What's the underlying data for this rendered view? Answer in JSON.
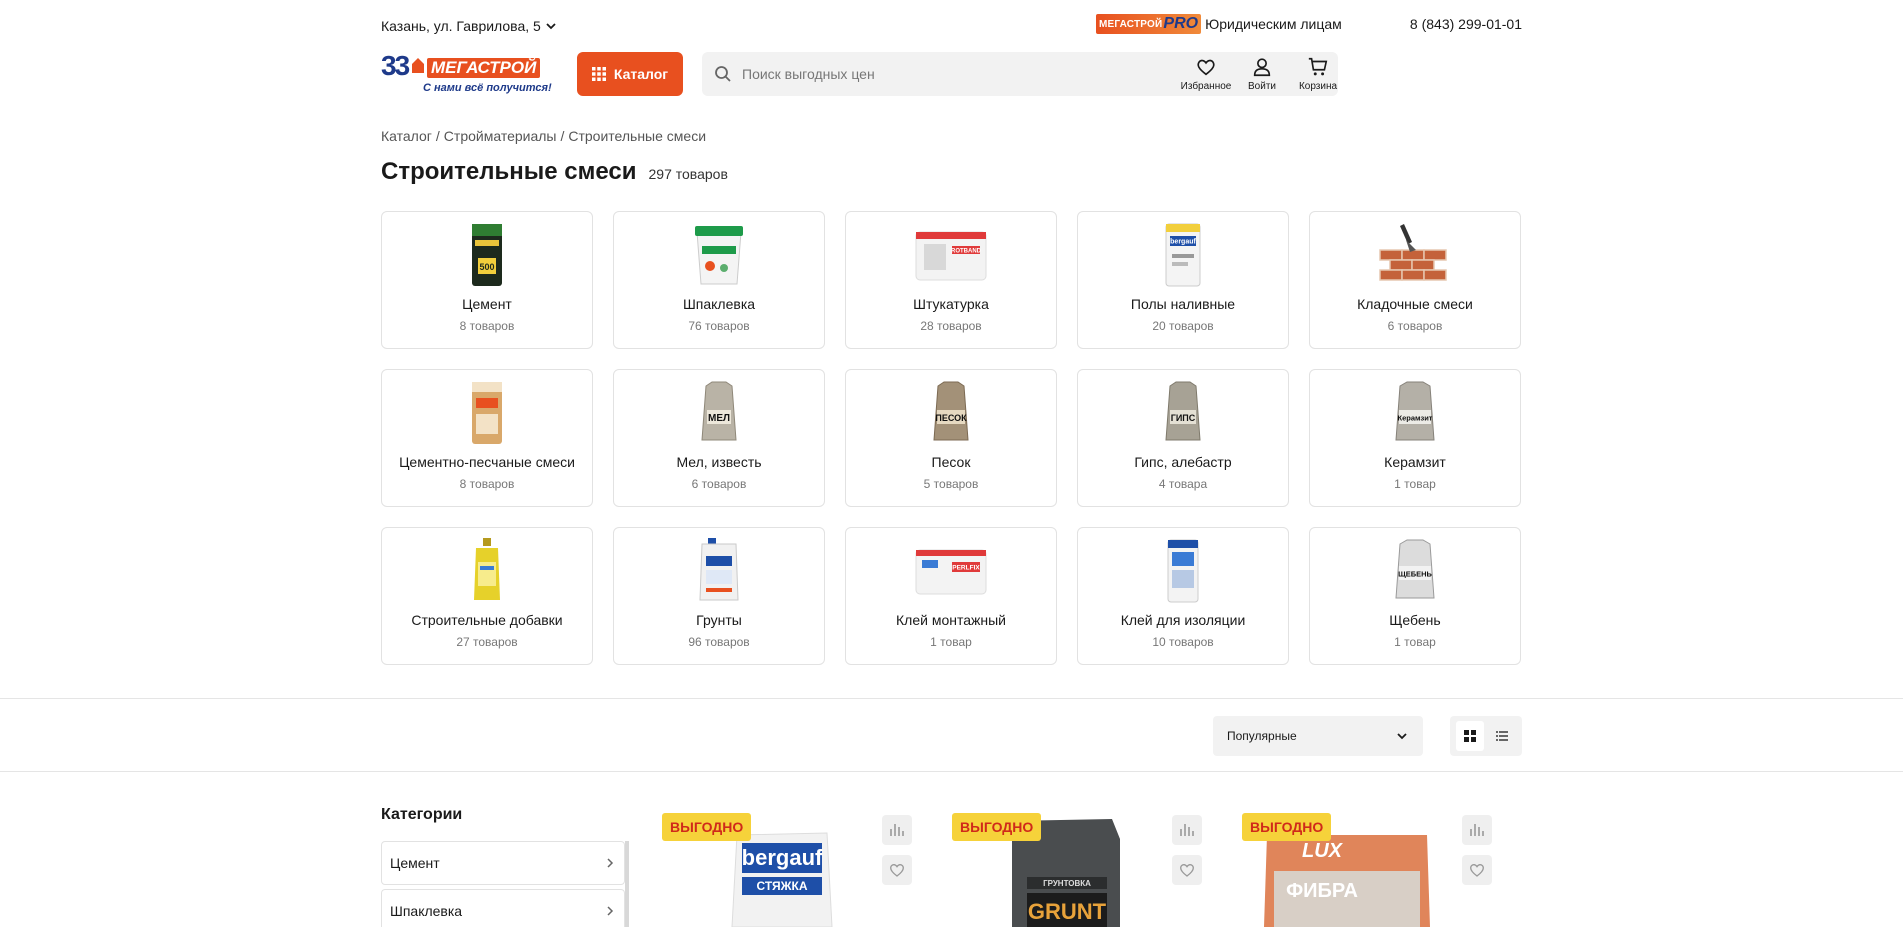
{
  "topbar": {
    "city": "Казань, ул. Гаврилова, 5",
    "pro_brand": "МЕГАСТРОЙ",
    "pro_suffix": "PRO",
    "legal": "Юридическим лицам",
    "phone": "8 (843) 299-01-01"
  },
  "header": {
    "logo_mark": "33",
    "logo_name": "МЕГАСТРОЙ",
    "logo_slogan": "С нами всё получится!",
    "catalog_label": "Каталог",
    "search_placeholder": "Поиск выгодных цен",
    "favorites_label": "Избранное",
    "login_label": "Войти",
    "cart_label": "Корзина"
  },
  "breadcrumbs": [
    "Каталог",
    "Стройматериалы",
    "Строительные смеси"
  ],
  "page": {
    "title": "Строительные смеси",
    "count": "297 товаров"
  },
  "categories": [
    {
      "name": "Цемент",
      "count": "8 товаров",
      "icon": "cement-bag-icon"
    },
    {
      "name": "Шпаклевка",
      "count": "76 товаров",
      "icon": "putty-bucket-icon"
    },
    {
      "name": "Штукатурка",
      "count": "28 товаров",
      "icon": "plaster-bag-icon"
    },
    {
      "name": "Полы наливные",
      "count": "20 товаров",
      "icon": "floor-mix-bag-icon"
    },
    {
      "name": "Кладочные смеси",
      "count": "6 товаров",
      "icon": "brick-wall-icon"
    },
    {
      "name": "Цементно-песчаные смеси",
      "count": "8 товаров",
      "icon": "cement-sand-bag-icon"
    },
    {
      "name": "Мел, известь",
      "count": "6 товаров",
      "icon": "chalk-sack-icon",
      "sack_label": "МЕЛ"
    },
    {
      "name": "Песок",
      "count": "5 товаров",
      "icon": "sand-sack-icon",
      "sack_label": "ПЕСОК"
    },
    {
      "name": "Гипс, алебастр",
      "count": "4 товара",
      "icon": "gypsum-sack-icon",
      "sack_label": "ГИПС"
    },
    {
      "name": "Керамзит",
      "count": "1 товар",
      "icon": "claydite-sack-icon",
      "sack_label": "Керамзит"
    },
    {
      "name": "Строительные добавки",
      "count": "27 товаров",
      "icon": "additive-bottle-icon"
    },
    {
      "name": "Грунты",
      "count": "96 товаров",
      "icon": "primer-canister-icon"
    },
    {
      "name": "Клей монтажный",
      "count": "1 товар",
      "icon": "mounting-glue-bag-icon"
    },
    {
      "name": "Клей для изоляции",
      "count": "10 товаров",
      "icon": "insulation-glue-bag-icon"
    },
    {
      "name": "Щебень",
      "count": "1 товар",
      "icon": "gravel-sack-icon",
      "sack_label": "ЩЕБЕНЬ"
    }
  ],
  "toolbar": {
    "sort_value": "Популярные"
  },
  "sidebar": {
    "title": "Категории",
    "items": [
      "Цемент",
      "Шпаклевка"
    ]
  },
  "products": [
    {
      "badge": "ВЫГОДНО",
      "brand": "bergauf",
      "label": "СТЯЖКА"
    },
    {
      "badge": "ВЫГОДНО",
      "brand": "ГРУНТОВКА",
      "label": "GRUNT"
    },
    {
      "badge": "ВЫГОДНО",
      "brand": "LUX",
      "label": "ФИБРА"
    }
  ],
  "colors": {
    "accent": "#e8501f",
    "brand_blue": "#1e3a8a",
    "badge_bg": "#f6d23a",
    "badge_text": "#d02a1a"
  }
}
